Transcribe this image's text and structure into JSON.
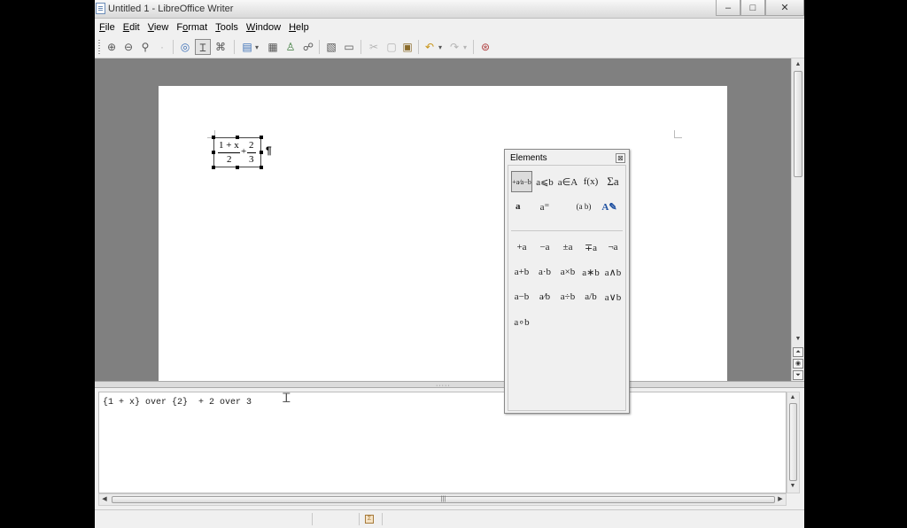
{
  "window": {
    "title": "Untitled 1 - LibreOffice Writer",
    "minimize": "–",
    "maximize": "□",
    "close": "✕"
  },
  "menu": [
    {
      "pre": "",
      "ul": "F",
      "post": "ile"
    },
    {
      "pre": "",
      "ul": "E",
      "post": "dit"
    },
    {
      "pre": "",
      "ul": "V",
      "post": "iew"
    },
    {
      "pre": "F",
      "ul": "o",
      "post": "rmat"
    },
    {
      "pre": "",
      "ul": "T",
      "post": "ools"
    },
    {
      "pre": "",
      "ul": "W",
      "post": "indow"
    },
    {
      "pre": "",
      "ul": "H",
      "post": "elp"
    }
  ],
  "toolbar": {
    "icons": [
      "zoom-in-icon",
      "zoom-out-icon",
      "zoom-100-icon",
      "zoom-page-icon",
      "update-icon",
      "formula-cursor-icon",
      "symbols-icon",
      "import-formula-icon",
      "select-all-icon",
      "fit-icon",
      "autoupdate-icon",
      "export-pdf-icon",
      "print-icon",
      "cut-icon",
      "copy-icon",
      "paste-icon",
      "undo-icon",
      "redo-icon",
      "help-icon"
    ],
    "glyphs": {
      "zoom_in": "⊕",
      "zoom_out": "⊖",
      "zoom_100": "⚲",
      "zoom_page": "·",
      "update": "◎",
      "formula_cursor": "Ɪ",
      "symbols": "⌘",
      "import": "▤",
      "import_arrow": "▾",
      "select_all": "▦",
      "fit": "♙",
      "autoupdate": "☍",
      "export_pdf": "▧",
      "print": "▭",
      "cut": "✂",
      "copy": "▢",
      "paste": "▣",
      "undo": "↶",
      "undo_arrow": "▾",
      "redo": "↷",
      "redo_arrow": "▾",
      "help": "⊛"
    }
  },
  "document": {
    "formula": {
      "num1": "1 + x",
      "den1": "2",
      "plus": "+",
      "num2": "2",
      "den2": "3"
    },
    "pilcrow": "¶"
  },
  "elements_panel": {
    "title": "Elements",
    "close": "⊠",
    "categories": [
      "+a/a-b",
      "a∈b",
      "a∊A",
      "f(x)",
      "Σa",
      "a⃗",
      "aᵀ",
      "()",
      "style"
    ],
    "category_glyphs": {
      "unary_binary": "+a⁄a−b",
      "relations": "a⩽b",
      "set": "a∈A",
      "functions": "f(x)",
      "operators": "Σa",
      "attributes": "a⃗",
      "others": "a⁼",
      "brackets": "(a b)",
      "formats": "A✎"
    },
    "items": [
      "+a",
      "−a",
      "±a",
      "∓a",
      "¬a",
      "a+b",
      "a·b",
      "a×b",
      "a∗b",
      "a∧b",
      "a−b",
      "a⁄b",
      "a÷b",
      "a/b",
      "a∨b",
      "a∘b"
    ]
  },
  "command": {
    "text": "{1 + x} over {2}  + 2 over 3",
    "cursor": "Ꮖ"
  },
  "scroll": {
    "up": "▲",
    "down": "▼",
    "left": "◀",
    "right": "▶",
    "prev_page": "⏶",
    "navigator": "◉",
    "next_page": "⏷",
    "grip": "|||",
    "splitter_grip": "·····"
  },
  "status": {
    "icon": "Σ"
  }
}
